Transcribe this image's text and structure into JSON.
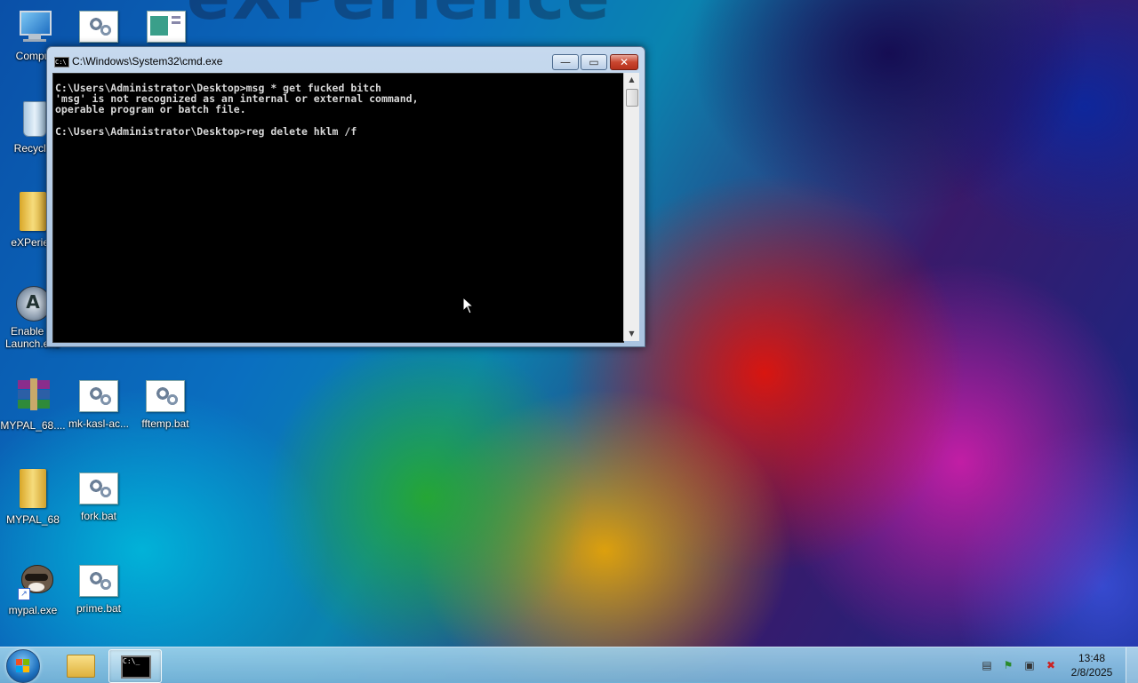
{
  "desktop": {
    "watermark": "eXPerience",
    "icons": [
      {
        "label": "Compu",
        "kind": "computer"
      },
      {
        "label": "",
        "kind": "bat"
      },
      {
        "label": "",
        "kind": "doc"
      },
      {
        "label": "Recycle",
        "kind": "recycle"
      },
      {
        "label": "eXPerien",
        "kind": "folder"
      },
      {
        "label": "Enable Q",
        "label2": "Launch.exe",
        "kind": "app"
      },
      {
        "label": "MYPAL_68....",
        "kind": "archive"
      },
      {
        "label": "mk-kasl-ac...",
        "kind": "bat"
      },
      {
        "label": "fftemp.bat",
        "kind": "bat"
      },
      {
        "label": "MYPAL_68",
        "kind": "folder"
      },
      {
        "label": "fork.bat",
        "kind": "bat"
      },
      {
        "label": "mypal.exe",
        "kind": "raccoon"
      },
      {
        "label": "prime.bat",
        "kind": "bat"
      }
    ]
  },
  "window": {
    "title": "C:\\Windows\\System32\\cmd.exe",
    "title_icon": "C:\\",
    "minimize_glyph": "—",
    "maximize_glyph": "▭",
    "close_glyph": "✕",
    "console_text": "C:\\Users\\Administrator\\Desktop>msg * get fucked bitch\n'msg' is not recognized as an internal or external command,\noperable program or batch file.\n\nC:\\Users\\Administrator\\Desktop>reg delete hklm /f"
  },
  "taskbar": {
    "clock_time": "13:48",
    "clock_date": "2/8/2025",
    "cmd_icon_text": "C:\\_"
  },
  "colors": {
    "console_bg": "#000000",
    "console_fg": "#d8d8d8",
    "close_button": "#c9462f"
  }
}
